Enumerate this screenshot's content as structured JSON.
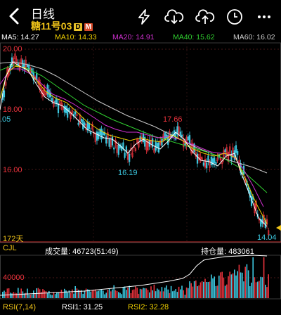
{
  "header": {
    "title": "日线",
    "subtitle": "糖11号03",
    "tag_d": "D",
    "tag_m": "M"
  },
  "ma_bar": {
    "ma5": "MA5: 14.27",
    "ma10": "MA10: 14.33",
    "ma20": "MA20: 14.91",
    "ma40": "MA40: 15.62",
    "ma60": "MA60: 16.02",
    "colors": {
      "ma5": "#ffffff",
      "ma10": "#f0d000",
      "ma20": "#d030d0",
      "ma40": "#30d030",
      "ma60": "#c8c8c8"
    }
  },
  "price_chart": {
    "y_ticks": [
      "20.00",
      "18.00",
      "16.00"
    ],
    "left_cut_label": ".05",
    "period_label": "172天",
    "high_mark": "17.66",
    "low_mark": "16.19",
    "last_mark": "14.04",
    "up_color": "#e8323c",
    "down_color": "#3cc8e0"
  },
  "volume_panel": {
    "indicator": "CJL",
    "volume_text": "成交量: 46723(51:49)",
    "oi_text": "持仓量: 483061",
    "y_tick": "40000"
  },
  "rsi_bar": {
    "rsi_label": "RSI(7,14)",
    "rsi1": "RSI1: 31.25",
    "rsi2": "RSI2: 32.28"
  }
}
